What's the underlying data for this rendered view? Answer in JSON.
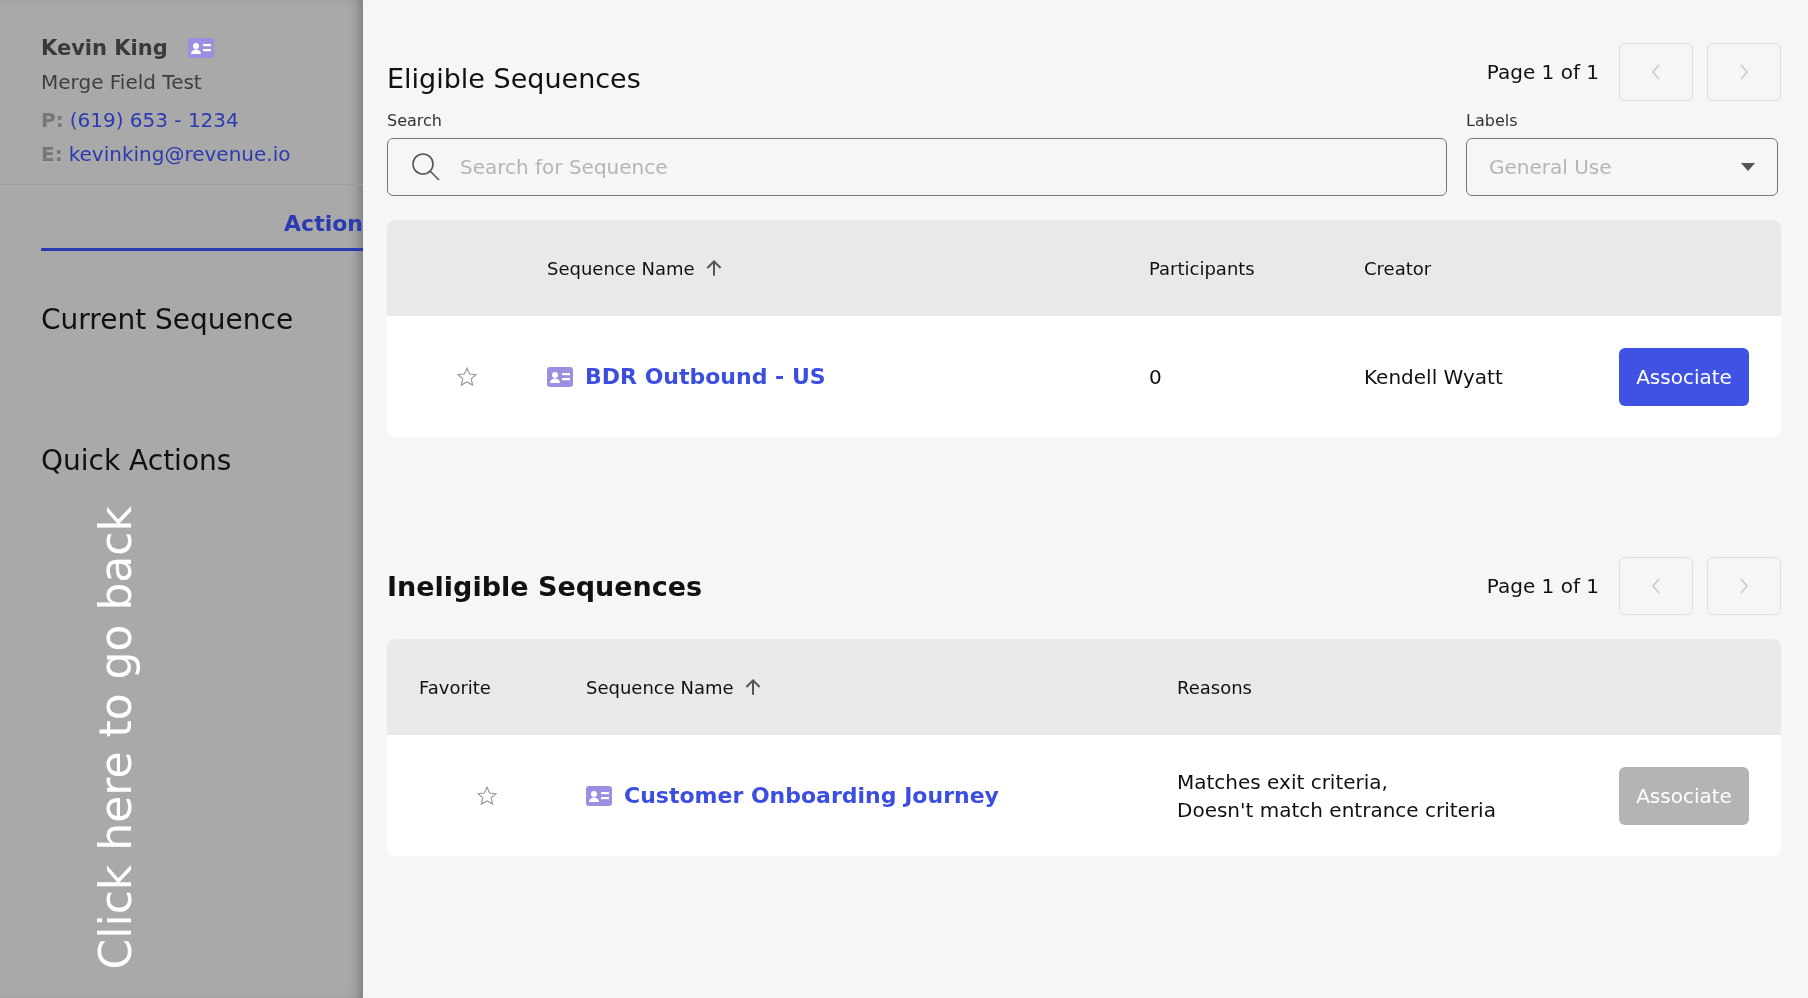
{
  "contact": {
    "name": "Kevin King",
    "subtitle": "Merge Field Test",
    "phone_label": "P:",
    "phone": "(619) 653 - 1234",
    "email_label": "E:",
    "email": "kevinking@revenue.io"
  },
  "tabs": [
    {
      "label": "Action",
      "selected": true
    }
  ],
  "sections": [
    "Current Sequence",
    "Quick Actions"
  ],
  "back_overlay": {
    "label": "Click here to go back"
  },
  "eligible": {
    "title": "Eligible Sequences",
    "pager": "Page 1 of 1",
    "search": {
      "label": "Search",
      "placeholder": "Search for Sequence"
    },
    "labels": {
      "label": "Labels",
      "placeholder": "General Use"
    },
    "columns": [
      "",
      "Sequence Name",
      "Participants",
      "Creator"
    ],
    "rows": [
      {
        "favorite": false,
        "name": "BDR Outbound - US",
        "participants": "0",
        "creator": "Kendell Wyatt",
        "action": {
          "label": "Associate",
          "disabled": false
        }
      }
    ]
  },
  "ineligible": {
    "title": "Ineligible Sequences",
    "pager": "Page 1 of 1",
    "columns": [
      "Favorite",
      "Sequence Name",
      "Reasons"
    ],
    "rows": [
      {
        "favorite": false,
        "name": "Customer Onboarding Journey",
        "reasons": [
          "Matches exit criteria,",
          "Doesn't match entrance criteria"
        ],
        "action": {
          "label": "Associate",
          "disabled": true
        }
      }
    ]
  }
}
